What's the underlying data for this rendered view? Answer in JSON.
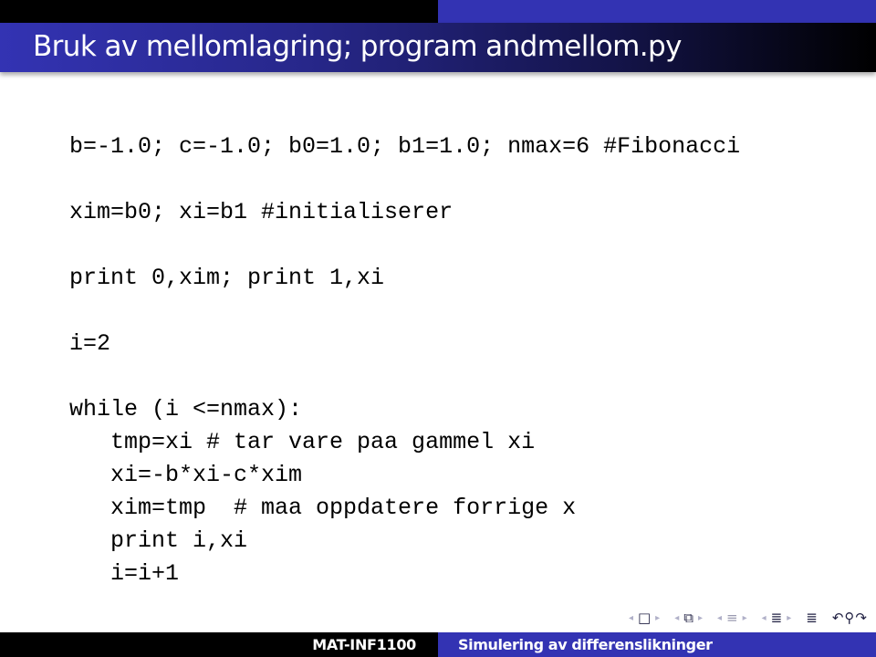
{
  "slide": {
    "title": "Bruk av mellomlagring; program andmellom.py",
    "code_lines": [
      "b=-1.0; c=-1.0; b0=1.0; b1=1.0; nmax=6 #Fibonacci",
      "xim=b0; xi=b1 #initialiserer",
      "print 0,xim; print 1,xi",
      "i=2",
      "while (i <=nmax):",
      "   tmp=xi # tar vare paa gammel xi",
      "   xi=-b*xi-c*xim",
      "   xim=tmp  # maa oppdatere forrige x",
      "   print i,xi",
      "   i=i+1"
    ]
  },
  "navigation": {
    "icons": [
      "slide-nav-icon",
      "frame-nav-icon",
      "subsection-nav-icon",
      "section-nav-icon",
      "document-outline-icon",
      "back-icon",
      "search-icon",
      "forward-icon"
    ],
    "arrow_left": "◂",
    "arrow_right": "▸",
    "slide_glyph": "□",
    "frame_glyph": "⧉",
    "subsection_glyph": "≡",
    "section_glyph": "≣",
    "outline_glyph": "≣",
    "back_glyph": "↶",
    "search_glyph": "⚲",
    "forward_glyph": "↷"
  },
  "footer": {
    "left": "MAT-INF1100",
    "right": "Simulering av differenslikninger"
  },
  "colors": {
    "accent_blue": "#3333b3",
    "black": "#000000"
  }
}
